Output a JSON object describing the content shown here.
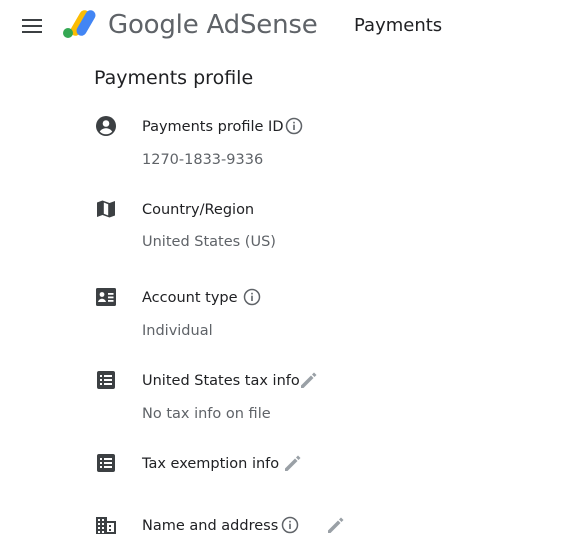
{
  "header": {
    "menu_icon": "hamburger-menu-icon",
    "brand": "Google AdSense",
    "page_title": "Payments"
  },
  "section": {
    "title": "Payments profile"
  },
  "rows": [
    {
      "icon": "account-circle-icon",
      "label": "Payments profile ID",
      "value": "1270-1833-9336",
      "has_info": true,
      "has_edit": false
    },
    {
      "icon": "map-icon",
      "label": "Country/Region",
      "value": "United States (US)",
      "has_info": false,
      "has_edit": false
    },
    {
      "icon": "contact-card-icon",
      "label": "Account type",
      "value": "Individual",
      "has_info": true,
      "has_edit": false
    },
    {
      "icon": "list-icon",
      "label": "United States tax info",
      "value": "No tax info on file",
      "has_info": false,
      "has_edit": true
    },
    {
      "icon": "list-icon",
      "label": "Tax exemption info",
      "value": "",
      "has_info": false,
      "has_edit": true
    },
    {
      "icon": "building-icon",
      "label": "Name and address",
      "value": "",
      "has_info": true,
      "has_edit": true
    }
  ],
  "colors": {
    "icon": "#3c4043",
    "muted_icon": "#5f6368",
    "edit_icon": "#9aa0a6",
    "logo_yellow": "#fbbc04",
    "logo_blue": "#4285f4",
    "logo_green": "#34a853"
  }
}
